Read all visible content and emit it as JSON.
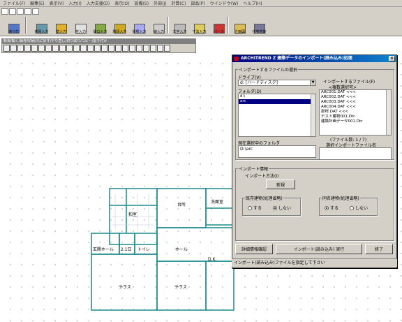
{
  "menu": [
    "ファイル(F)",
    "編集(E)",
    "表示(V)",
    "入力(I)",
    "入力支援(D)",
    "表示(O)",
    "設備(S)",
    "外部(J)",
    "計算(C)",
    "部品(P)",
    "ウインドウ(W)",
    "ヘルプ(H)"
  ],
  "toolbar": {
    "buttons": [
      {
        "label": "通り芯"
      },
      {
        "label": "部屋入力"
      },
      {
        "label": "壁入力"
      },
      {
        "label": "柱入力"
      },
      {
        "label": "開口入力"
      },
      {
        "label": "階段入力"
      },
      {
        "label": "屋根入力"
      },
      {
        "label": "線入力"
      },
      {
        "label": "文字入力"
      },
      {
        "label": "寸法入力"
      },
      {
        "label": "パース"
      },
      {
        "label": "立面図"
      },
      {
        "label": "住宅性能"
      }
    ]
  },
  "palette": {
    "title": "新規/開く/保存/印刷/元に戻す/やり直し/切り取り/コピー/貼り付け"
  },
  "plan": {
    "labels": [
      "和室",
      "台所",
      "洗面室",
      "玄関ホール",
      "トイレ",
      "ホール",
      "D.K.",
      "テラス",
      "テラス",
      "2.1日"
    ]
  },
  "dialog": {
    "title": "ARCHITREND Z 建築データのインポート(読み込み)処理",
    "close_icon": "close-icon",
    "file_group_label": "インポートするファイルの選択",
    "drive_label": "ドライブ(V)",
    "drive_value": "d: [ハードディスク]",
    "folder_label": "フォルダ(D)",
    "folders": [
      "d:\\",
      "arc"
    ],
    "files_label": "インポートするファイル(F)",
    "files_hint": "<複数選択可>",
    "files": [
      "ARC001.DAT <<<",
      "ARC002.DAT <<<",
      "ARC003.DAT <<<",
      "ARC004.DAT <<<",
      "部材.DAT <<<",
      "テスト建物001.Dtr",
      "建築計画データ001.Dtr"
    ],
    "current_folder_label": "現在選択中のフォルダ",
    "current_folder_value": "D:\\arc",
    "selected_count_label": "(ファイル数: 1 / 7)",
    "import_file_label": "選択インポートファイル名",
    "import_info_label": "インポート情報",
    "import_method_label": "インポート方法(I)",
    "import_method_button": "新規",
    "existing_group_label": "既存建物(処理省略)",
    "existing_yes": "する",
    "existing_no": "しない",
    "overwrite_group_label": "同名建物(処理省略)",
    "overwrite_yes": "する",
    "overwrite_no": "しない",
    "detail_button": "詳細情報確認",
    "import_button": "インポート(読み込み) 実行",
    "help_button": "終了",
    "status": "インポート(読み込み)ファイルを指定して下さい"
  }
}
